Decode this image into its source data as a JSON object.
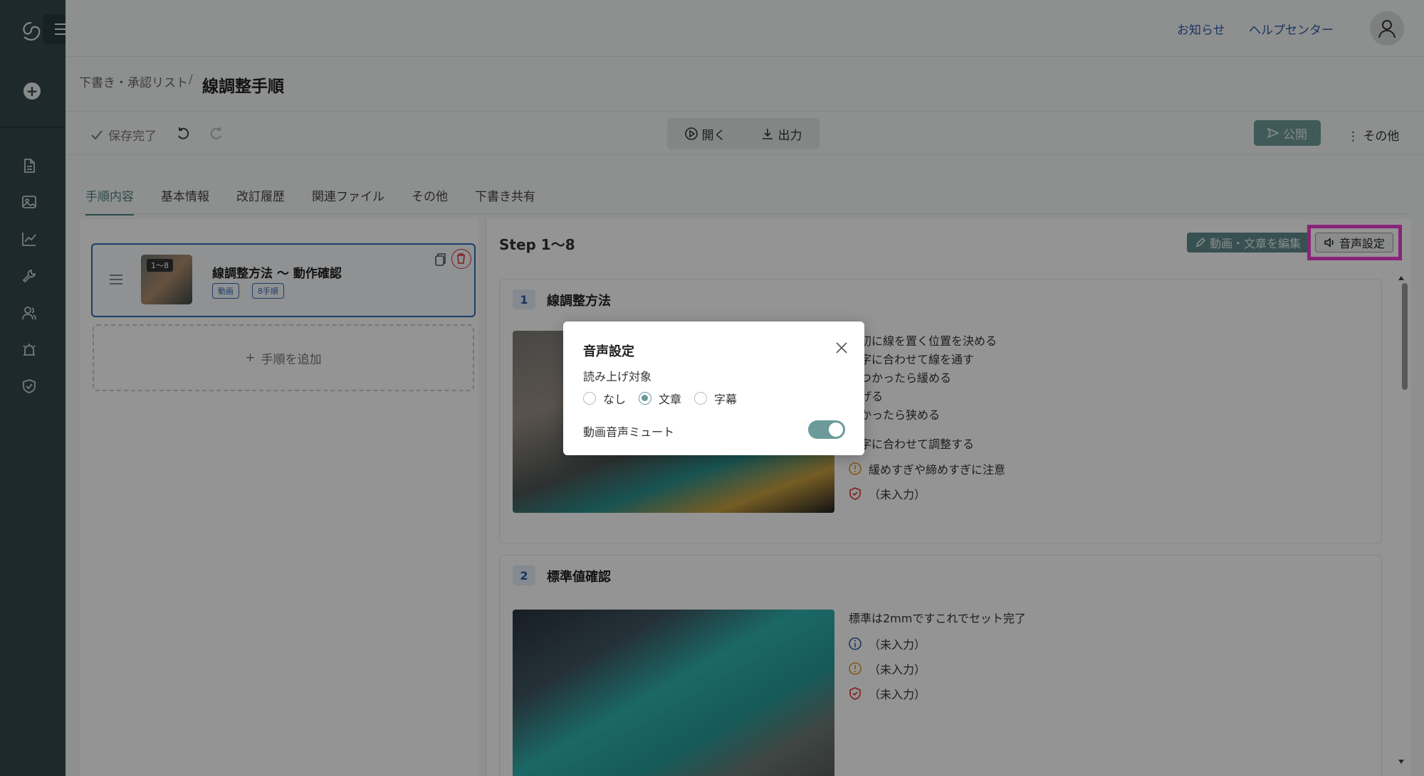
{
  "header": {
    "news_link": "お知らせ",
    "help_link": "ヘルプセンター"
  },
  "breadcrumb": {
    "parent": "下書き・承認リスト",
    "separator": "/",
    "title": "線調整手順"
  },
  "toolbar": {
    "save_status": "保存完了",
    "open_label": "開く",
    "export_label": "出力",
    "publish_label": "公開",
    "more_label": "その他"
  },
  "tabs": [
    {
      "label": "手順内容",
      "active": true
    },
    {
      "label": "基本情報"
    },
    {
      "label": "改訂履歴"
    },
    {
      "label": "関連ファイル"
    },
    {
      "label": "その他"
    },
    {
      "label": "下書き共有"
    }
  ],
  "step_list": {
    "card": {
      "range_badge": "1～8",
      "title": "線調整方法 〜 動作確認",
      "tag_video": "動画",
      "tag_steps": "8手順"
    },
    "add_label": "手順を追加"
  },
  "detail": {
    "range": "Step 1〜8",
    "edit_button": "動画・文章を編集",
    "voice_button": "音声設定",
    "steps": [
      {
        "number": "1",
        "name": "線調整方法",
        "lines": [
          "最初に線を置く位置を決める",
          "数字に合わせて線を通す",
          "きつかったら緩める",
          "広げる",
          "緩かったら狭める"
        ],
        "line_extra": "数字に合わせて調整する",
        "caution": "緩めすぎや締めすぎに注意",
        "check": "（未入力）"
      },
      {
        "number": "2",
        "name": "標準値確認",
        "line": "標準は2mmですこれでセット完了",
        "info": "（未入力）",
        "caution": "（未入力）",
        "check": "（未入力）"
      }
    ]
  },
  "modal": {
    "title": "音声設定",
    "read_target_label": "読み上げ対象",
    "options": [
      "なし",
      "文章",
      "字幕"
    ],
    "selected_option": "文章",
    "mute_label": "動画音声ミュート",
    "mute_enabled": true
  },
  "colors": {
    "sidebar": "#33474a",
    "accent": "#6c9a9a",
    "link": "#2d5fa8",
    "highlight": "#e83fcd"
  }
}
